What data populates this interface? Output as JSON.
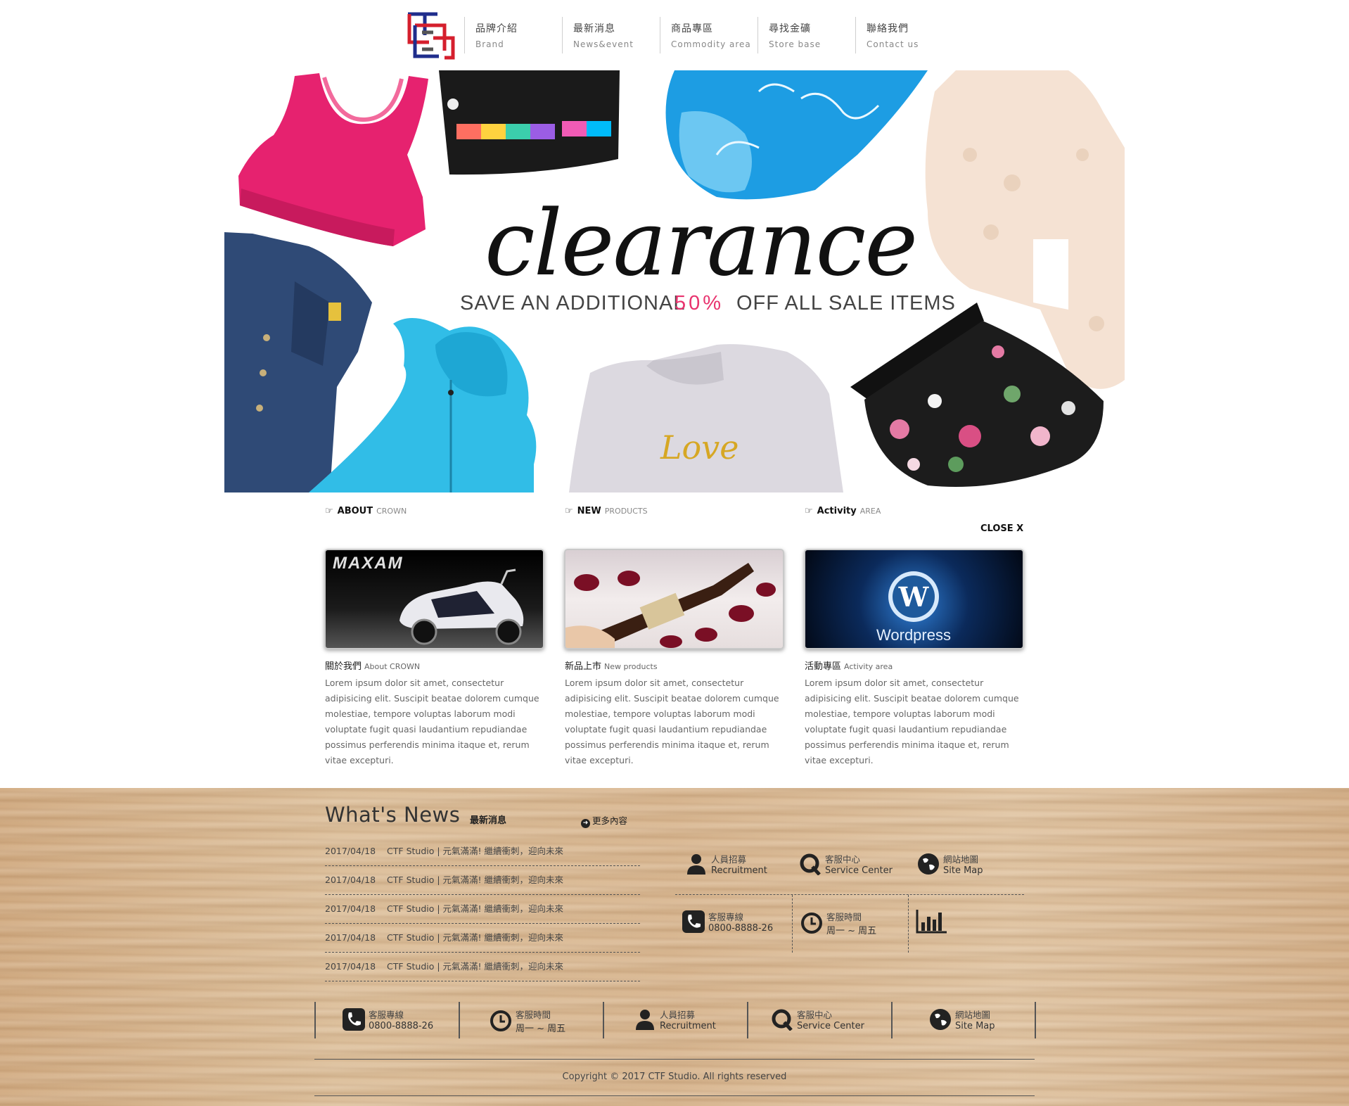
{
  "nav": [
    {
      "zh": "品牌介紹",
      "en": "Brand"
    },
    {
      "zh": "最新消息",
      "en": "News&event"
    },
    {
      "zh": "商品專區",
      "en": "Commodity area"
    },
    {
      "zh": "尋找金礦",
      "en": "Store base"
    },
    {
      "zh": "聯絡我們",
      "en": "Contact us"
    }
  ],
  "banner": {
    "script_word": "clearance",
    "line_pre": "SAVE AN ADDITIONAL",
    "line_pct": "50%",
    "line_post": "OFF ALL SALE ITEMS",
    "shirt_text": "Love"
  },
  "columns": [
    {
      "head_bold": "ABOUT",
      "head_sub": "CROWN",
      "thumb_text": "MAXAM",
      "title": "關於我們",
      "title_small": "About CROWN",
      "text": "Lorem ipsum dolor sit amet, consectetur adipisicing elit. Suscipit beatae dolorem cumque molestiae, tempore voluptas laborum modi voluptate fugit quasi laudantium repudiandae possimus perferendis minima itaque et, rerum vitae excepturi."
    },
    {
      "head_bold": "NEW",
      "head_sub": "PRODUCTS",
      "thumb_text": "",
      "title": "新品上市",
      "title_small": "New products",
      "text": "Lorem ipsum dolor sit amet, consectetur adipisicing elit. Suscipit beatae dolorem cumque molestiae, tempore voluptas laborum modi voluptate fugit quasi laudantium repudiandae possimus perferendis minima itaque et, rerum vitae excepturi."
    },
    {
      "head_bold": "Activity",
      "head_sub": "AREA",
      "thumb_text": "Wordpress",
      "title": "活動專區",
      "title_small": "Activity area",
      "text": "Lorem ipsum dolor sit amet, consectetur adipisicing elit. Suscipit beatae dolorem cumque molestiae, tempore voluptas laborum modi voluptate fugit quasi laudantium repudiandae possimus perferendis minima itaque et, rerum vitae excepturi."
    }
  ],
  "close_label": "CLOSE X",
  "news": {
    "title": "What's News",
    "title_zh": "最新消息",
    "more": "更多內容",
    "items": [
      {
        "date": "2017/04/18",
        "text": "CTF Studio | 元氣滿滿! 繼續衝刺，迎向未來"
      },
      {
        "date": "2017/04/18",
        "text": "CTF Studio | 元氣滿滿! 繼續衝刺，迎向未來"
      },
      {
        "date": "2017/04/18",
        "text": "CTF Studio | 元氣滿滿! 繼續衝刺，迎向未來"
      },
      {
        "date": "2017/04/18",
        "text": "CTF Studio | 元氣滿滿! 繼續衝刺，迎向未來"
      },
      {
        "date": "2017/04/18",
        "text": "CTF Studio | 元氣滿滿! 繼續衝刺，迎向未來"
      }
    ]
  },
  "services": {
    "recruit": {
      "zh": "人員招募",
      "en": "Recruitment",
      "icon": "person-icon"
    },
    "service": {
      "zh": "客服中心",
      "en": "Service Center",
      "icon": "q-icon"
    },
    "sitemap": {
      "zh": "網站地圖",
      "en": "Site Map",
      "icon": "globe-icon"
    },
    "hotline": {
      "zh": "客服專線",
      "en": "0800-8888-26",
      "icon": "phone-icon"
    },
    "hours": {
      "zh": "客服時間",
      "en": "周一 ~ 周五",
      "icon": "clock-icon"
    },
    "stats": {
      "icon": "bar-chart-icon"
    }
  },
  "copyright": "Copyright © 2017 CTF Studio. All rights reserved",
  "colors": {
    "accent_pink": "#e8336e",
    "logo_red": "#d51f2d",
    "logo_blue": "#1f2d8c"
  }
}
